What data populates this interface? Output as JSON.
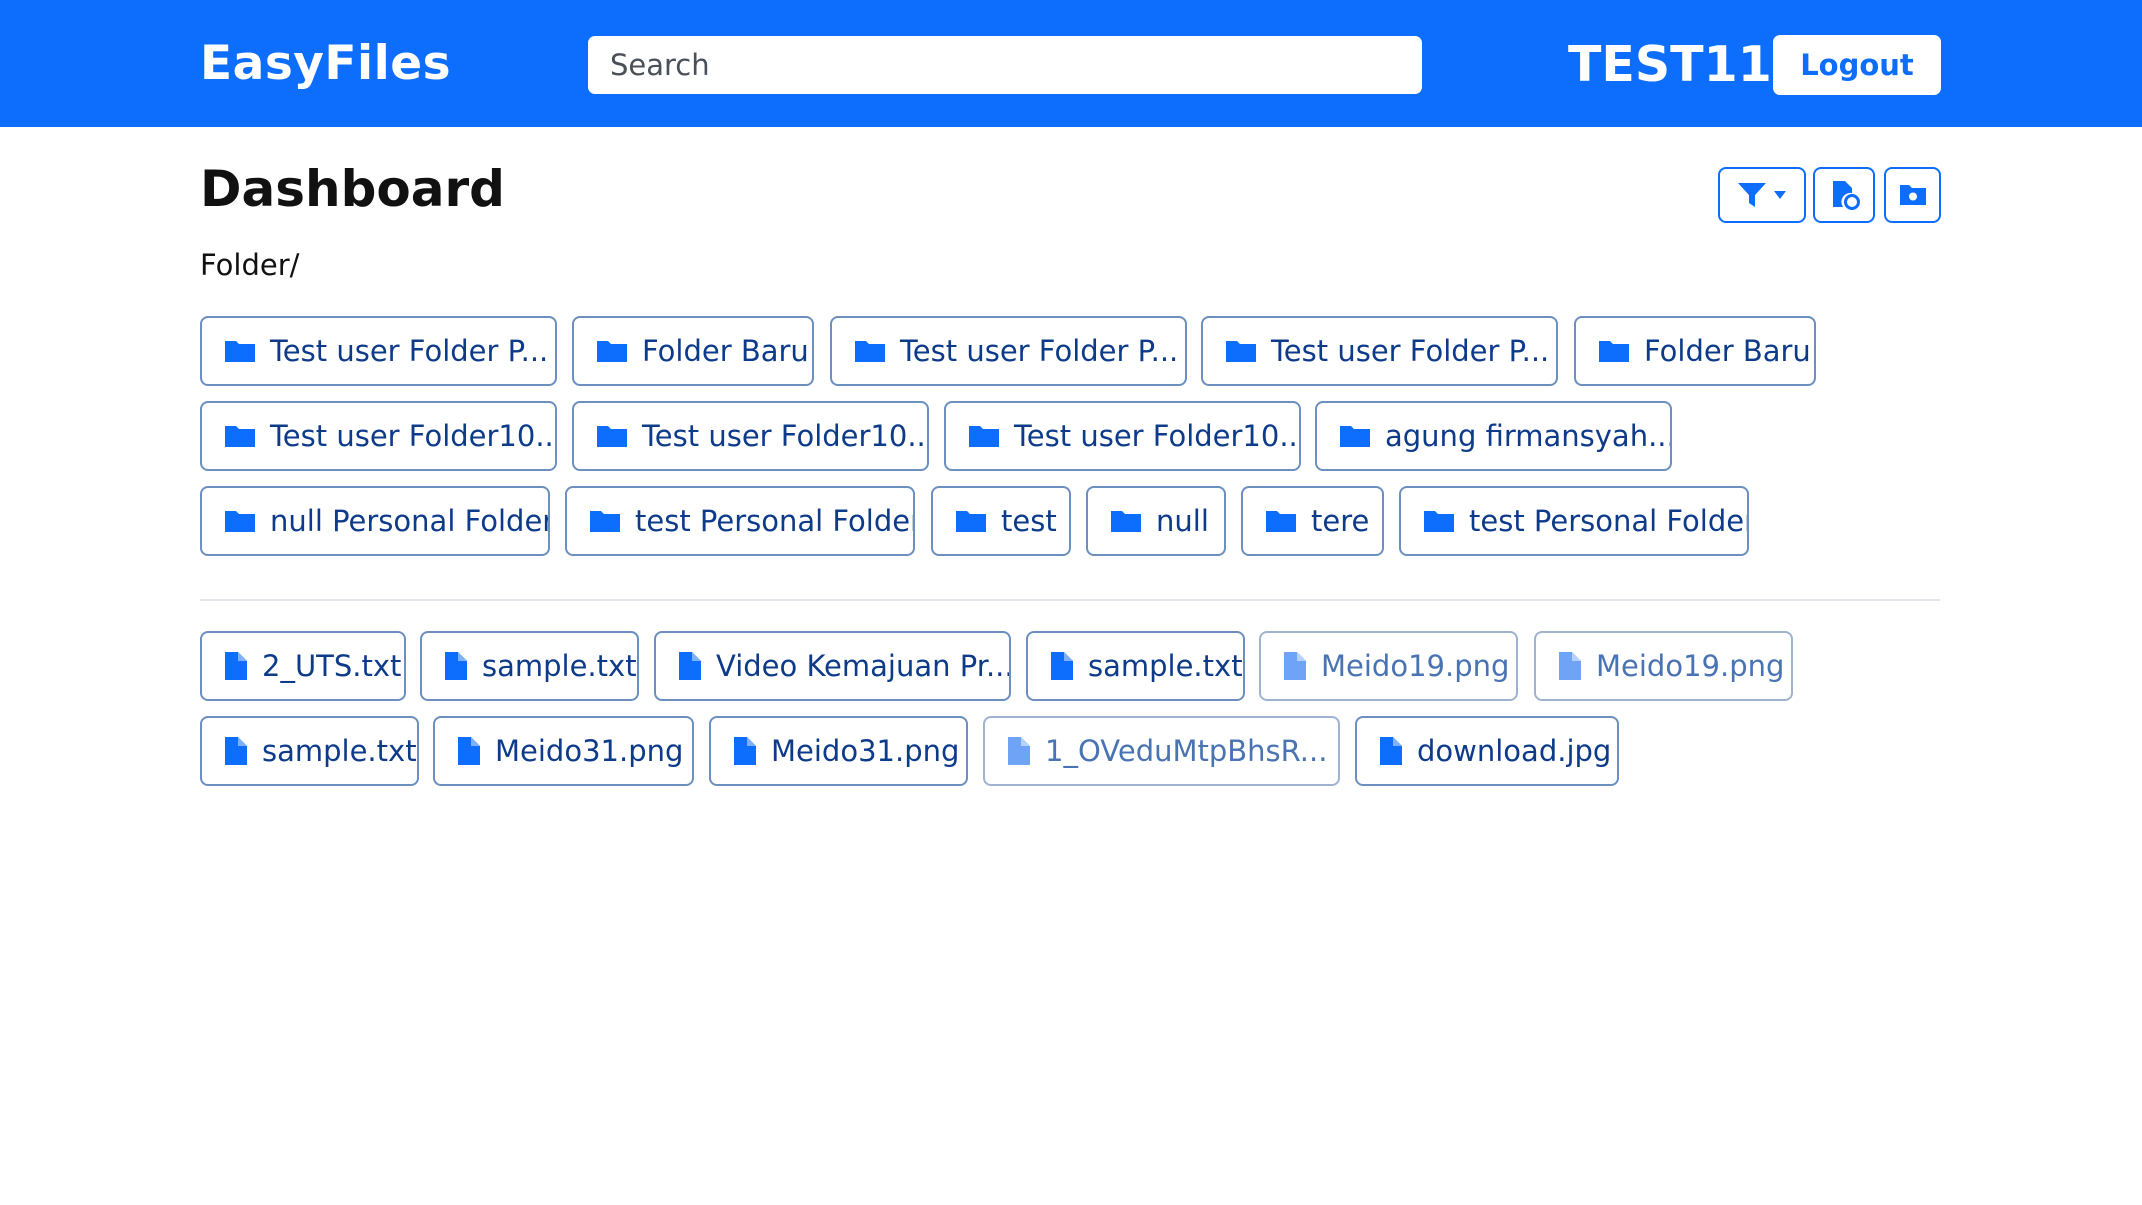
{
  "app": {
    "brand": "EasyFiles",
    "accent_color": "#0d6efd"
  },
  "header": {
    "search_placeholder": "Search",
    "username": "TEST11",
    "logout_label": "Logout"
  },
  "page": {
    "title": "Dashboard",
    "breadcrumb": "Folder/"
  },
  "toolbar": {
    "filter_icon": "filter-icon",
    "dropdown_icon": "caret-down-icon",
    "add_file_icon": "file-plus-icon",
    "add_folder_icon": "folder-plus-icon"
  },
  "folders": [
    {
      "label": "Test user Folder P..."
    },
    {
      "label": "Folder Baru"
    },
    {
      "label": "Test user Folder P..."
    },
    {
      "label": "Test user Folder P..."
    },
    {
      "label": "Folder Baru"
    },
    {
      "label": "Test user Folder10..."
    },
    {
      "label": "Test user Folder10..."
    },
    {
      "label": "Test user Folder10..."
    },
    {
      "label": "agung firmansyah..."
    },
    {
      "label": "null Personal Folder"
    },
    {
      "label": "test Personal Folder"
    },
    {
      "label": "test"
    },
    {
      "label": "null"
    },
    {
      "label": "tere"
    },
    {
      "label": "test Personal Folder"
    }
  ],
  "files": [
    {
      "label": "2_UTS.txt"
    },
    {
      "label": "sample.txt"
    },
    {
      "label": "Video Kemajuan Pr..."
    },
    {
      "label": "sample.txt"
    },
    {
      "label": "Meido19.png"
    },
    {
      "label": "Meido19.png"
    },
    {
      "label": "sample.txt"
    },
    {
      "label": "Meido31.png"
    },
    {
      "label": "Meido31.png"
    },
    {
      "label": "1_OVeduMtpBhsR..."
    },
    {
      "label": "download.jpg"
    }
  ]
}
